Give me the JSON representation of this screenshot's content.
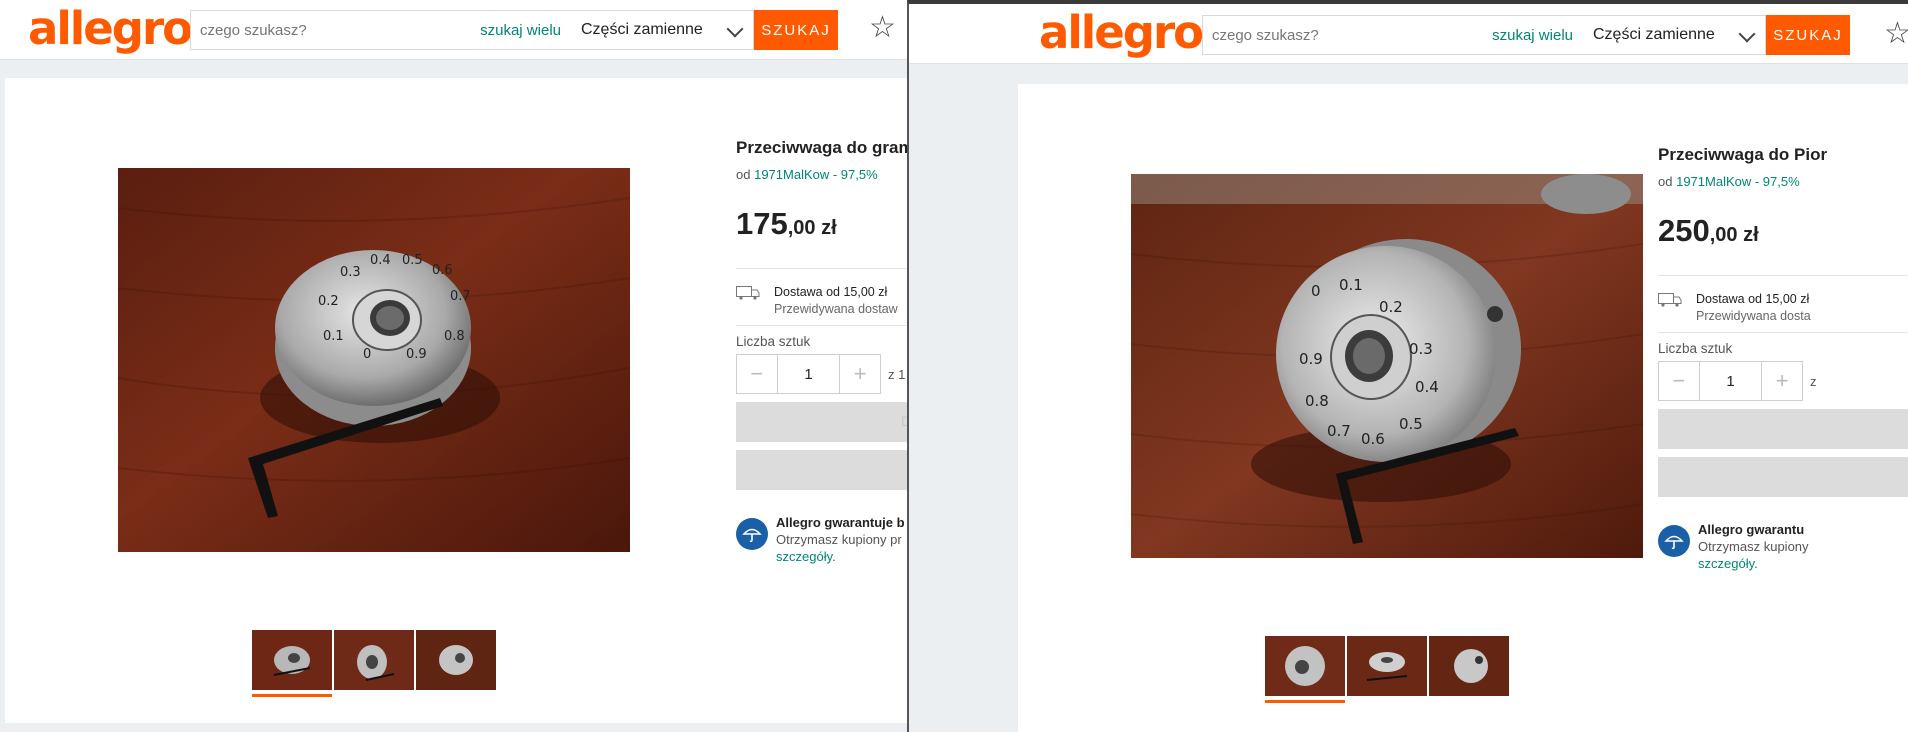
{
  "brand": {
    "logo_text": "allegro",
    "accent": "#ff5a00",
    "link_color": "#008673"
  },
  "left": {
    "search": {
      "placeholder": "czego szukasz?",
      "many": "szukaj wielu",
      "category": "Części zamienne",
      "button": "SZUKAJ"
    },
    "product": {
      "title": "Przeciwwaga do gramo",
      "seller_prefix": "od",
      "seller": "1971MalKow - 97,5%",
      "price_int": "175",
      "price_dec": ",00 zł",
      "delivery": "Dostawa od 15,00 zł",
      "delivery_sub": "Przewidywana dostaw",
      "qty_label": "Liczba sztuk",
      "qty_value": "1",
      "qty_of": "z 1",
      "btn1_label": "D",
      "guarantee_title": "Allegro gwarantuje b",
      "guarantee_line": "Otrzymasz kupiony pr",
      "guarantee_link": "szczegóły",
      "guarantee_dot": "."
    }
  },
  "right": {
    "search": {
      "placeholder": "czego szukasz?",
      "many": "szukaj wielu",
      "category": "Części zamienne",
      "button": "SZUKAJ"
    },
    "product": {
      "title": "Przeciwwaga do Pior",
      "seller_prefix": "od",
      "seller": "1971MalKow - 97,5%",
      "price_int": "250",
      "price_dec": ",00 zł",
      "delivery": "Dostawa od 15,00 zł",
      "delivery_sub": "Przewidywana dosta",
      "qty_label": "Liczba sztuk",
      "qty_value": "1",
      "qty_of": "z",
      "guarantee_title": "Allegro gwarantu",
      "guarantee_line": "Otrzymasz kupiony",
      "guarantee_link": "szczegóły",
      "guarantee_dot": "."
    }
  },
  "icons": [
    "star-icon",
    "chevron-down-icon",
    "truck-icon",
    "umbrella-icon",
    "minus-icon",
    "plus-icon"
  ],
  "photo_marks": {
    "left": [
      "0",
      "0.1",
      "0.2",
      "0.3",
      "0.4",
      "0.5",
      "0.6",
      "0.7",
      "0.8",
      "0.9",
      "0"
    ],
    "right": [
      "0",
      "0.1",
      "0.2",
      "0.3",
      "0.4",
      "0.5",
      "0.6",
      "0.7",
      "0.8",
      "0.9"
    ]
  }
}
